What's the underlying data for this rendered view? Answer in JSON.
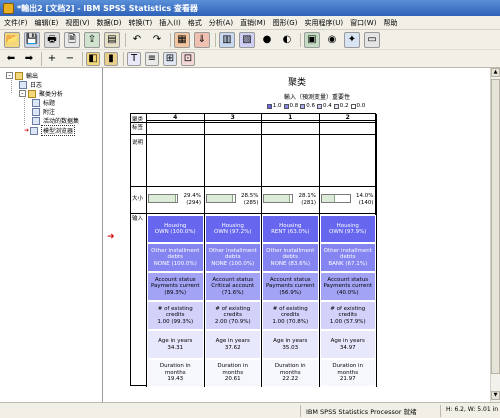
{
  "window": {
    "title": "*輸出2 [文档2] - IBM SPSS Statistics 查看器"
  },
  "menu": [
    "文件(F)",
    "编辑(E)",
    "视图(V)",
    "数据(D)",
    "转换(T)",
    "插入(I)",
    "格式",
    "分析(A)",
    "直销(M)",
    "图形(G)",
    "实用程序(U)",
    "窗口(W)",
    "帮助"
  ],
  "toolbar1_icons": [
    "open-folder-icon",
    "save-icon",
    "print-icon",
    "print-preview-icon",
    "export-icon",
    "recall-dialog-icon",
    "undo-icon",
    "redo-icon",
    "goto-data-icon",
    "goto-case-icon",
    "goto-variable-icon",
    "variables-icon",
    "cases-icon",
    "value-labels-icon",
    "select-cases-icon",
    "show-all-icon",
    "designate-window-icon",
    "insert-heading-icon"
  ],
  "toolbar2_icons": [
    "promote-icon",
    "demote-icon",
    "expand-icon",
    "collapse-icon",
    "show-icon",
    "hide-icon",
    "insert-title-icon",
    "insert-text-icon",
    "insert-page-break-icon",
    "insert-new-output-icon"
  ],
  "tree": [
    {
      "label": "輸出",
      "level": 0,
      "type": "folder",
      "expander": "-"
    },
    {
      "label": "日志",
      "level": 1,
      "type": "log"
    },
    {
      "label": "聚类分析",
      "level": 1,
      "type": "folder",
      "expander": "-"
    },
    {
      "label": "标题",
      "level": 2,
      "type": "item"
    },
    {
      "label": "附注",
      "level": 2,
      "type": "item"
    },
    {
      "label": "活动的数据集",
      "level": 2,
      "type": "item"
    },
    {
      "label": "模型浏览器",
      "level": 2,
      "type": "item",
      "selected": true
    }
  ],
  "output": {
    "title": "聚类",
    "legend": {
      "title": "輸入（預測变量）重要性",
      "items": [
        {
          "label": "1.0",
          "color": "#6666ee"
        },
        {
          "label": "0.8",
          "color": "#8888f0"
        },
        {
          "label": "0.6",
          "color": "#aaaaf4"
        },
        {
          "label": "0.4",
          "color": "#ccccf8"
        },
        {
          "label": "0.2",
          "color": "#e6e6fb"
        },
        {
          "label": "0.0",
          "color": "#ffffff"
        }
      ]
    },
    "row_labels": {
      "cluster": "聚类",
      "label": "标签",
      "description": "说明",
      "size": "大小",
      "inputs": "输入"
    },
    "clusters": [
      {
        "id": "4",
        "size_pct": "29.4%",
        "size_n": "(294)",
        "size_frac": 0.294
      },
      {
        "id": "3",
        "size_pct": "28.5%",
        "size_n": "(285)",
        "size_frac": 0.285
      },
      {
        "id": "1",
        "size_pct": "28.1%",
        "size_n": "(281)",
        "size_frac": 0.281
      },
      {
        "id": "2",
        "size_pct": "14.0%",
        "size_n": "(140)",
        "size_frac": 0.14
      }
    ],
    "feature_rows": [
      {
        "importance": 1.0,
        "cells": [
          "Housing\nOWN (100.0%)",
          "Housing\nOWN (97.2%)",
          "Housing\nRENT (63.0%)",
          "Housing\nOWN (97.9%)"
        ]
      },
      {
        "importance": 0.8,
        "cells": [
          "Other installment\ndebts\nNONE (100.0%)",
          "Other installment\ndebts\nNONE (100.0%)",
          "Other installment\ndebts\nNONE (83.6%)",
          "Other installment\ndebts\nBANK (67.1%)"
        ]
      },
      {
        "importance": 0.6,
        "cells": [
          "Account status\nPayments current\n(89.3%)",
          "Account status\nCritical account\n(71.6%)",
          "Account status\nPayments current\n(56.9%)",
          "Account status\nPayments current\n(40.0%)"
        ]
      },
      {
        "importance": 0.3,
        "cells": [
          "# of existing credits\n1.00 (99.3%)",
          "# of existing credits\n2.00 (70.9%)",
          "# of existing credits\n1.00 (70.8%)",
          "# of existing credits\n1.00 (57.9%)"
        ]
      },
      {
        "importance": 0.15,
        "cells": [
          "Age in years\n34.31",
          "Age in years\n37.62",
          "Age in years\n35.03",
          "Age in years\n34.97"
        ]
      },
      {
        "importance": 0.05,
        "cells": [
          "Duration in months\n19.43",
          "Duration in months\n20.61",
          "Duration in months\n22.22",
          "Duration in months\n21.97"
        ]
      }
    ]
  },
  "status": {
    "main": "IBM SPSS Statistics Processor 就绪",
    "dims": "H: 6.2, W: 5.01 in"
  }
}
